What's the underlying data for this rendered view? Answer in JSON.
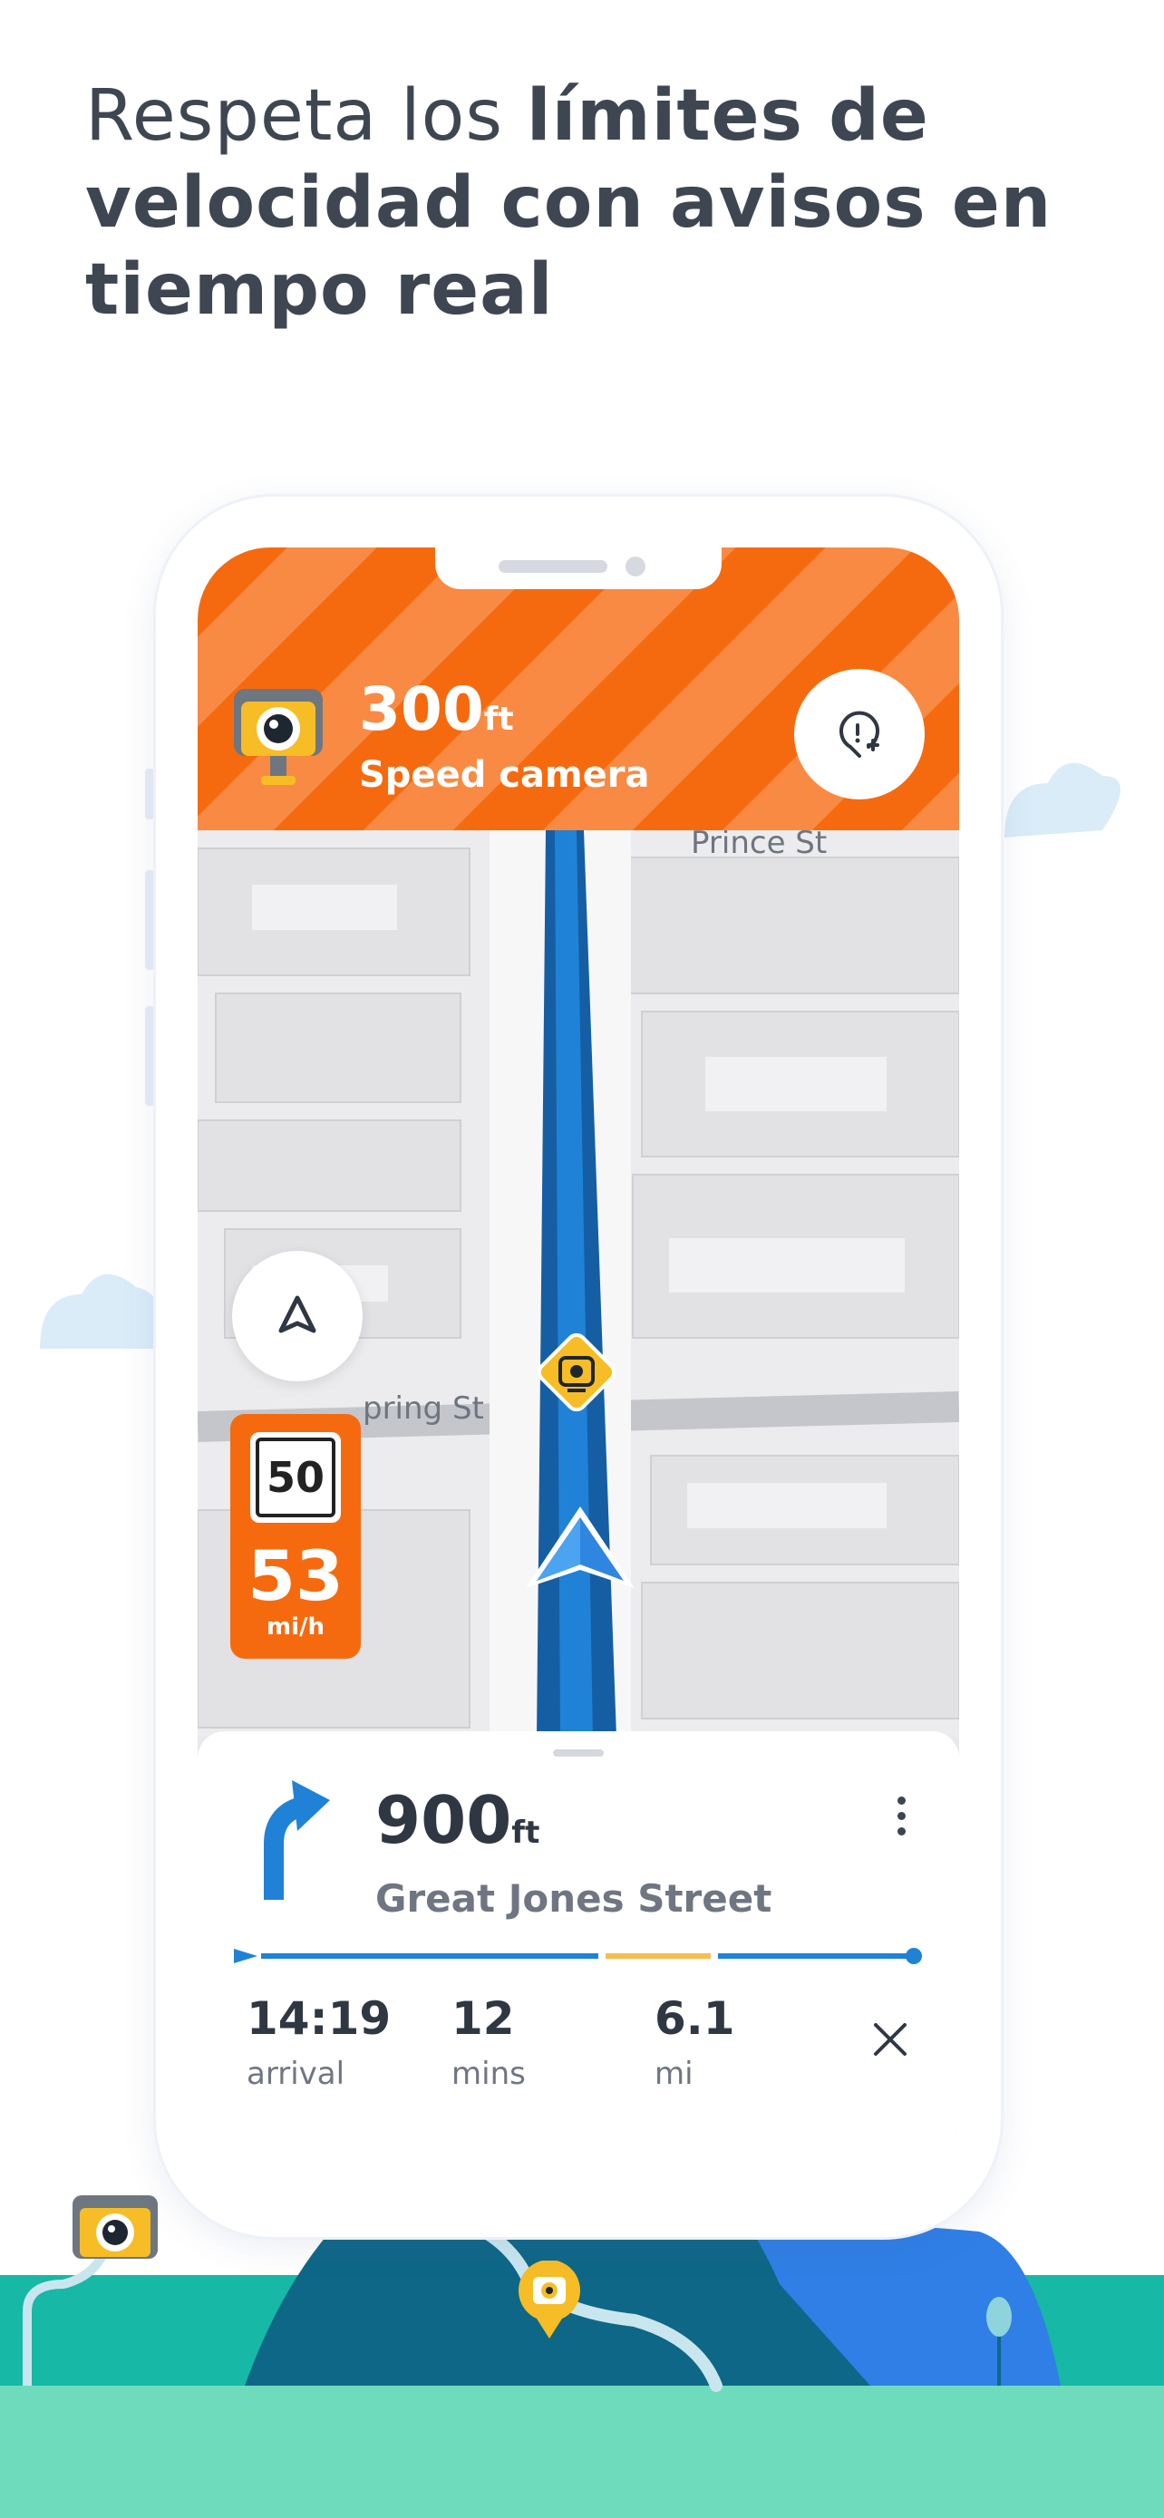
{
  "headline": {
    "part1": "Respeta los ",
    "bold1": "límites de velocidad con avisos en tiempo real"
  },
  "alert": {
    "distance": "300",
    "distance_unit": "ft",
    "label": "Speed camera",
    "report_icon": "pin-add-icon"
  },
  "map": {
    "streets": [
      "Prince St",
      "pring St"
    ]
  },
  "speed": {
    "limit": "50",
    "current": "53",
    "unit": "mi/h"
  },
  "instruction": {
    "distance": "900",
    "distance_unit": "ft",
    "street": "Great Jones Street"
  },
  "trip": {
    "arrival_value": "14:19",
    "arrival_label": "arrival",
    "duration_value": "12",
    "duration_label": "mins",
    "distance_value": "6.1",
    "distance_label": "mi"
  },
  "colors": {
    "alert_orange": "#f66a0f",
    "route_blue": "#1f7fd0",
    "camera_yellow": "#f6bd26",
    "ground_teal": "#17b8a6"
  }
}
